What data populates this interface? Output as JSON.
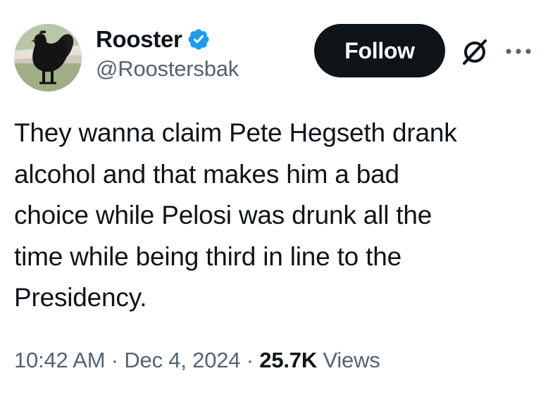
{
  "author": {
    "display_name": "Rooster",
    "handle": "@Roostersbak",
    "verified_icon": "verified-badge-icon",
    "avatar_icon": "rooster-avatar"
  },
  "actions": {
    "follow_label": "Follow",
    "grok_icon": "grok-icon",
    "more_icon": "more-dots-icon"
  },
  "tweet": {
    "text": "They wanna claim Pete Hegseth drank\nalcohol and that makes him a bad\nchoice while Pelosi was drunk all the\ntime while being third in line to the\nPresidency."
  },
  "meta": {
    "time": "10:42 AM",
    "separator": " · ",
    "date": "Dec 4, 2024",
    "views_count": "25.7K",
    "views_label": "Views"
  },
  "colors": {
    "text_primary": "#0f1419",
    "text_secondary": "#536471",
    "verified_blue": "#1d9bf0",
    "button_bg": "#0f1419"
  }
}
